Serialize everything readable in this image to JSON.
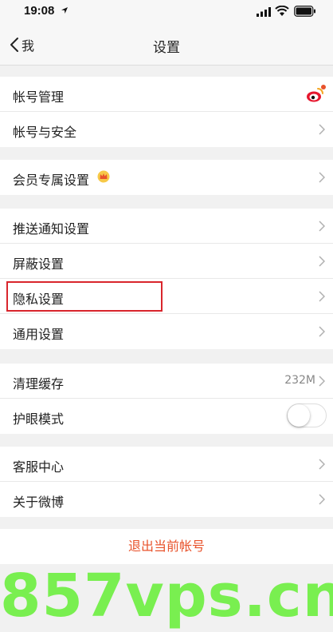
{
  "status": {
    "time": "19:08"
  },
  "nav": {
    "back_label": "我",
    "title": "设置"
  },
  "groups": {
    "account": [
      {
        "label": "帐号管理"
      },
      {
        "label": "帐号与安全"
      }
    ],
    "member": [
      {
        "label": "会员专属设置"
      }
    ],
    "settings": [
      {
        "label": "推送通知设置"
      },
      {
        "label": "屏蔽设置"
      },
      {
        "label": "隐私设置"
      },
      {
        "label": "通用设置"
      }
    ],
    "storage": [
      {
        "label": "清理缓存",
        "value": "232M"
      },
      {
        "label": "护眼模式",
        "toggle_on": false
      }
    ],
    "about": [
      {
        "label": "客服中心"
      },
      {
        "label": "关于微博"
      }
    ]
  },
  "logout_label": "退出当前帐号",
  "watermark": "857vps.cn",
  "colors": {
    "accent": "#e8532c",
    "highlight": "#d9252c",
    "watermark": "#73ef48"
  }
}
